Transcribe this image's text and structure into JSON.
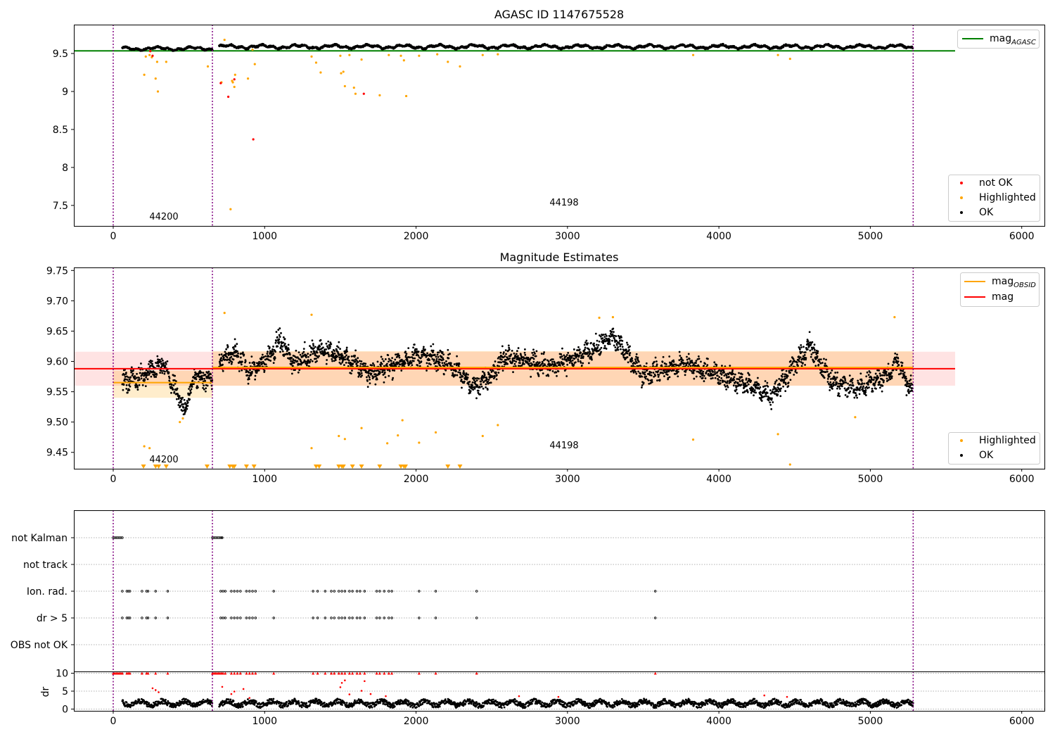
{
  "chart_data": [
    {
      "type": "scatter",
      "title": "AGASC ID 1147675528",
      "xlim": [
        -260,
        6150
      ],
      "ylim": [
        7.23,
        9.88
      ],
      "xticks": [
        0,
        1000,
        2000,
        3000,
        4000,
        5000,
        6000
      ],
      "yticks": [
        7.5,
        8.0,
        8.5,
        9.0,
        9.5
      ],
      "vlines": [
        0,
        655,
        5283
      ],
      "hlines": [
        {
          "name": "mag_AGASC",
          "value": 9.535,
          "color": "#008000",
          "xrange": [
            -260,
            5560
          ]
        }
      ],
      "obsid_labels": [
        {
          "text": "44200",
          "x": 325,
          "y": 7.33
        },
        {
          "text": "44198",
          "x": 2970,
          "y": 7.51
        }
      ],
      "legend_top": {
        "position": "upper right",
        "entries": [
          {
            "label": "mag",
            "subscript": "AGASC",
            "color": "#008000"
          }
        ]
      },
      "legend_bottom": {
        "position": "lower right",
        "entries": [
          {
            "label": "not OK",
            "color": "#ff0000"
          },
          {
            "label": "Highlighted",
            "color": "#ffa500"
          },
          {
            "label": "OK",
            "color": "#000000"
          }
        ]
      },
      "ok_band": {
        "segments": [
          {
            "x": [
              60,
              655
            ],
            "center": 9.565,
            "amp": 0.03
          },
          {
            "x": [
              700,
              5280
            ],
            "center": 9.59,
            "amp": 0.035
          }
        ]
      },
      "highlighted": [
        [
          205,
          9.22
        ],
        [
          215,
          9.46
        ],
        [
          240,
          9.48
        ],
        [
          255,
          9.45
        ],
        [
          280,
          9.17
        ],
        [
          290,
          9.39
        ],
        [
          295,
          9.0
        ],
        [
          350,
          9.39
        ],
        [
          625,
          9.33
        ],
        [
          715,
          9.12
        ],
        [
          735,
          9.68
        ],
        [
          775,
          7.45
        ],
        [
          785,
          9.14
        ],
        [
          790,
          9.12
        ],
        [
          800,
          9.06
        ],
        [
          805,
          9.22
        ],
        [
          890,
          9.17
        ],
        [
          920,
          9.55
        ],
        [
          935,
          9.36
        ],
        [
          1310,
          9.46
        ],
        [
          1340,
          9.38
        ],
        [
          1370,
          9.25
        ],
        [
          1500,
          9.47
        ],
        [
          1505,
          9.24
        ],
        [
          1520,
          9.26
        ],
        [
          1530,
          9.07
        ],
        [
          1560,
          9.48
        ],
        [
          1590,
          9.05
        ],
        [
          1600,
          8.97
        ],
        [
          1640,
          9.42
        ],
        [
          1760,
          8.95
        ],
        [
          1820,
          9.48
        ],
        [
          1900,
          9.47
        ],
        [
          1920,
          9.41
        ],
        [
          1935,
          8.94
        ],
        [
          2020,
          9.47
        ],
        [
          2140,
          9.49
        ],
        [
          2210,
          9.39
        ],
        [
          2290,
          9.33
        ],
        [
          2440,
          9.48
        ],
        [
          2540,
          9.49
        ],
        [
          3830,
          9.48
        ],
        [
          4390,
          9.48
        ],
        [
          4470,
          9.43
        ]
      ],
      "not_ok": [
        [
          245,
          9.53
        ],
        [
          260,
          9.47
        ],
        [
          710,
          9.11
        ],
        [
          760,
          8.93
        ],
        [
          800,
          9.16
        ],
        [
          925,
          8.37
        ],
        [
          1655,
          8.97
        ]
      ]
    },
    {
      "type": "scatter",
      "title": "Magnitude Estimates",
      "xlim": [
        -260,
        6150
      ],
      "ylim": [
        9.423,
        9.755
      ],
      "xticks": [
        0,
        1000,
        2000,
        3000,
        4000,
        5000,
        6000
      ],
      "yticks": [
        9.45,
        9.5,
        9.55,
        9.6,
        9.65,
        9.7,
        9.75
      ],
      "vlines": [
        0,
        655,
        5283
      ],
      "mag": {
        "value": 9.588,
        "band": [
          9.56,
          9.616
        ],
        "xrange": [
          -260,
          5560
        ]
      },
      "mag_obsid": [
        {
          "obsid": "44200",
          "value": 9.565,
          "band": [
            9.54,
            9.585
          ],
          "xrange": [
            0,
            655
          ]
        },
        {
          "obsid": "44198",
          "value": 9.59,
          "band": [
            9.56,
            9.617
          ],
          "xrange": [
            655,
            5283
          ]
        }
      ],
      "obsid_labels": [
        {
          "text": "44200",
          "x": 325,
          "y": 9.435
        },
        {
          "text": "44198",
          "x": 2970,
          "y": 9.46
        }
      ],
      "legend_top": {
        "position": "upper right",
        "entries": [
          {
            "label": "mag",
            "subscript": "OBSID",
            "color": "#ffa500"
          },
          {
            "label": "mag",
            "subscript": "",
            "color": "#ff0000"
          }
        ]
      },
      "legend_bottom": {
        "position": "lower right",
        "entries": [
          {
            "label": "Highlighted",
            "color": "#ffa500"
          },
          {
            "label": "OK",
            "color": "#000000"
          }
        ]
      },
      "ok_series": {
        "segments": [
          {
            "x": [
              60,
              655
            ],
            "trend": [
              [
                60,
                9.565
              ],
              [
                200,
                9.575
              ],
              [
                330,
                9.595
              ],
              [
                420,
                9.545
              ],
              [
                470,
                9.52
              ],
              [
                540,
                9.575
              ],
              [
                655,
                9.57
              ]
            ]
          },
          {
            "x": [
              700,
              5280
            ],
            "trend": [
              [
                700,
                9.6
              ],
              [
                800,
                9.615
              ],
              [
                900,
                9.58
              ],
              [
                1000,
                9.6
              ],
              [
                1100,
                9.635
              ],
              [
                1200,
                9.595
              ],
              [
                1350,
                9.62
              ],
              [
                1500,
                9.61
              ],
              [
                1700,
                9.58
              ],
              [
                2000,
                9.61
              ],
              [
                2200,
                9.6
              ],
              [
                2400,
                9.555
              ],
              [
                2600,
                9.61
              ],
              [
                2900,
                9.59
              ],
              [
                3100,
                9.61
              ],
              [
                3300,
                9.64
              ],
              [
                3500,
                9.58
              ],
              [
                3800,
                9.595
              ],
              [
                4100,
                9.57
              ],
              [
                4350,
                9.545
              ],
              [
                4600,
                9.625
              ],
              [
                4750,
                9.565
              ],
              [
                4900,
                9.555
              ],
              [
                5100,
                9.575
              ],
              [
                5180,
                9.6
              ],
              [
                5283,
                9.545
              ]
            ]
          }
        ]
      },
      "highlighted": [
        [
          205,
          9.46
        ],
        [
          240,
          9.457
        ],
        [
          440,
          9.5
        ],
        [
          460,
          9.506
        ],
        [
          735,
          9.68
        ],
        [
          1310,
          9.677
        ],
        [
          1310,
          9.457
        ],
        [
          1490,
          9.477
        ],
        [
          1530,
          9.472
        ],
        [
          1640,
          9.49
        ],
        [
          1810,
          9.465
        ],
        [
          1880,
          9.478
        ],
        [
          1910,
          9.503
        ],
        [
          2020,
          9.466
        ],
        [
          2130,
          9.483
        ],
        [
          2440,
          9.477
        ],
        [
          2540,
          9.495
        ],
        [
          3210,
          9.672
        ],
        [
          3300,
          9.673
        ],
        [
          3830,
          9.471
        ],
        [
          4390,
          9.48
        ],
        [
          4470,
          9.43
        ],
        [
          4900,
          9.508
        ],
        [
          5160,
          9.673
        ]
      ],
      "below_axis_markers": [
        200,
        280,
        300,
        350,
        620,
        770,
        790,
        800,
        880,
        930,
        1340,
        1360,
        1490,
        1510,
        1520,
        1580,
        1640,
        1760,
        1900,
        1920,
        1930,
        2210,
        2290
      ]
    },
    {
      "type": "scatter",
      "xlim": [
        -260,
        6150
      ],
      "xticks": [
        0,
        1000,
        2000,
        3000,
        4000,
        5000,
        6000
      ],
      "vlines": [
        0,
        655,
        5283
      ],
      "categories": [
        "not Kalman",
        "not track",
        "Ion. rad.",
        "dr > 5",
        "OBS not OK"
      ],
      "flags": {
        "not Kalman": [
          0,
          10,
          20,
          30,
          40,
          50,
          60,
          655,
          665,
          675,
          685,
          695,
          705,
          715,
          720
        ],
        "not track": [],
        "Ion. rad.": [
          60,
          90,
          100,
          110,
          190,
          220,
          230,
          280,
          360,
          710,
          725,
          740,
          780,
          800,
          820,
          840,
          880,
          900,
          920,
          940,
          1060,
          1320,
          1350,
          1400,
          1440,
          1460,
          1490,
          1510,
          1530,
          1560,
          1580,
          1610,
          1630,
          1660,
          1740,
          1760,
          1790,
          1820,
          1840,
          2020,
          2130,
          2400,
          3580
        ],
        "dr > 5": [
          60,
          90,
          100,
          110,
          190,
          220,
          230,
          280,
          360,
          710,
          725,
          740,
          780,
          800,
          820,
          840,
          880,
          900,
          920,
          940,
          1060,
          1320,
          1350,
          1400,
          1440,
          1460,
          1490,
          1510,
          1530,
          1560,
          1580,
          1610,
          1630,
          1660,
          1740,
          1760,
          1790,
          1820,
          1840,
          2020,
          2130,
          2400,
          3580
        ],
        "OBS not OK": []
      }
    },
    {
      "type": "scatter",
      "ylabel": "dr",
      "xlim": [
        -260,
        6150
      ],
      "ylim": [
        -0.5,
        10.5
      ],
      "xticks": [
        0,
        1000,
        2000,
        3000,
        4000,
        5000,
        6000
      ],
      "yticks": [
        0,
        5,
        10
      ],
      "vlines": [
        0,
        655,
        5283
      ],
      "clipped_at": 10,
      "red_at_clip": [
        0,
        10,
        20,
        30,
        40,
        50,
        60,
        90,
        100,
        110,
        190,
        220,
        230,
        280,
        360,
        655,
        665,
        675,
        685,
        695,
        705,
        715,
        725,
        740,
        780,
        800,
        820,
        840,
        880,
        900,
        920,
        940,
        1060,
        1320,
        1350,
        1400,
        1440,
        1460,
        1490,
        1510,
        1530,
        1560,
        1580,
        1610,
        1630,
        1660,
        1740,
        1760,
        1790,
        1820,
        1840,
        2020,
        2130,
        2400,
        3580
      ],
      "red_mid": [
        [
          260,
          5.8
        ],
        [
          280,
          5.3
        ],
        [
          300,
          4.7
        ],
        [
          720,
          6.2
        ],
        [
          780,
          4.2
        ],
        [
          800,
          4.9
        ],
        [
          860,
          5.6
        ],
        [
          900,
          3.1
        ],
        [
          1500,
          6.1
        ],
        [
          1510,
          7.3
        ],
        [
          1530,
          8.0
        ],
        [
          1560,
          4.1
        ],
        [
          1640,
          5.1
        ],
        [
          1660,
          7.8
        ],
        [
          1700,
          4.2
        ],
        [
          1800,
          3.6
        ],
        [
          2680,
          3.6
        ],
        [
          2940,
          3.4
        ],
        [
          4300,
          3.8
        ],
        [
          4450,
          3.4
        ]
      ],
      "ok_range": [
        [
          60,
          655
        ],
        [
          700,
          5283
        ]
      ]
    }
  ]
}
